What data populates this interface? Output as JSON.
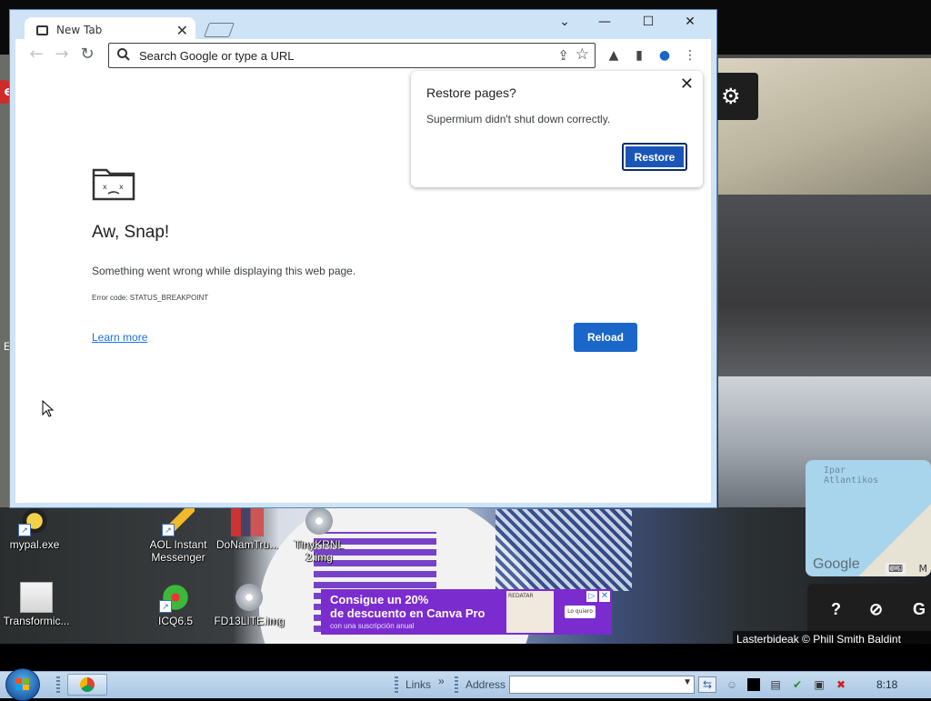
{
  "browser": {
    "tab_title": "New Tab",
    "omnibox_placeholder": "Search Google or type a URL",
    "page": {
      "title": "Aw, Snap!",
      "message": "Something went wrong while displaying this web page.",
      "error_code": "Error code: STATUS_BREAKPOINT",
      "learn_more": "Learn more",
      "reload_label": "Reload"
    },
    "restore_bubble": {
      "title": "Restore pages?",
      "message": "Supermium didn't shut down correctly.",
      "button": "Restore"
    },
    "accent_color": "#1a66c9"
  },
  "desktop": {
    "icons": [
      {
        "label": "mypal.exe"
      },
      {
        "label": "AOL Instant Messenger"
      },
      {
        "label": "DoNamTru..."
      },
      {
        "label": "TinyKRNL 2.img"
      },
      {
        "label": "Transformic..."
      },
      {
        "label": "ICQ6.5"
      },
      {
        "label": "FD13LITE.img"
      }
    ],
    "wallpaper": {
      "map_ocean_label": "Ipar\nAtlantikos",
      "map_logo": "Google",
      "credit": "Lasterbideak  © Phill Smith  Baldint",
      "ad_line1": "Consigue un 20%",
      "ad_line2": "de descuento en Canva Pro",
      "ad_line3": "con una suscripción anual",
      "ad_cta": "Lo quiero",
      "ad_product": "REDATAR"
    }
  },
  "taskbar": {
    "links_label": "Links",
    "address_label": "Address",
    "address_value": "",
    "clock": "8:18"
  }
}
